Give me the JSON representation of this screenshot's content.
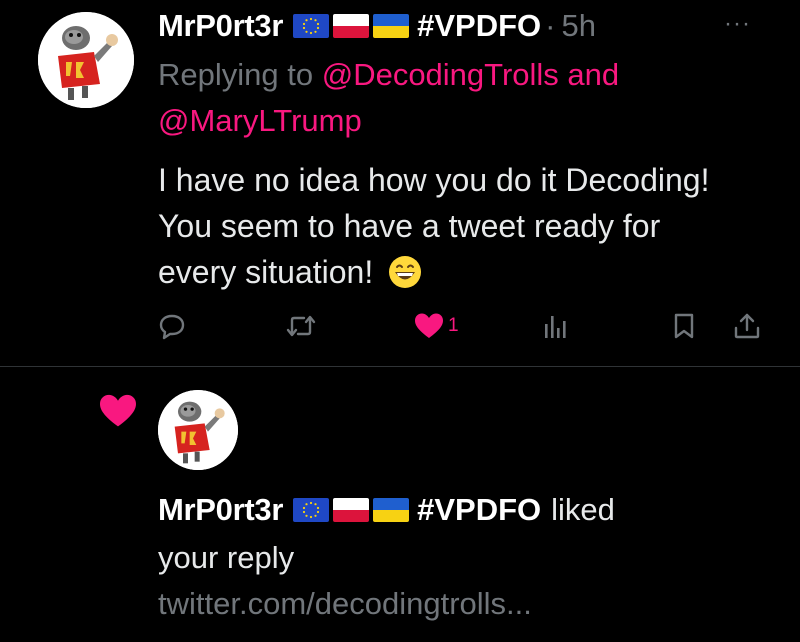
{
  "tweet": {
    "author_name": "MrP0rt3r",
    "flags": [
      "eu-flag",
      "poland-flag",
      "ukraine-flag"
    ],
    "hashtag": "#VPDFO",
    "separator": "·",
    "time": "5h",
    "more_icon": "···",
    "replying_prefix": "Replying to",
    "mention_1": "@DecodingTrolls",
    "mention_and": "and",
    "mention_2": "@MaryLTrump",
    "text_line_1": "I have no idea how you do it Decoding!",
    "text_line_2": "You seem to have a tweet ready for",
    "text_line_3": "every situation!",
    "emoji": "grinning-face-emoji",
    "actions": {
      "reply_icon": "reply-icon",
      "retweet_icon": "retweet-icon",
      "like_icon": "heart-icon",
      "like_count": "1",
      "views_icon": "analytics-icon",
      "bookmark_icon": "bookmark-icon",
      "share_icon": "share-icon"
    }
  },
  "notification": {
    "icon": "heart-icon",
    "user_name": "MrP0rt3r",
    "hashtag": "#VPDFO",
    "action_text": "liked",
    "action_text_2": "your reply",
    "link_text": "twitter.com/decodingtrolls..."
  },
  "colors": {
    "background": "#000000",
    "text_primary": "#e7e9ea",
    "text_secondary": "#71767b",
    "accent_pink": "#f91880",
    "divider": "#2f3336"
  }
}
